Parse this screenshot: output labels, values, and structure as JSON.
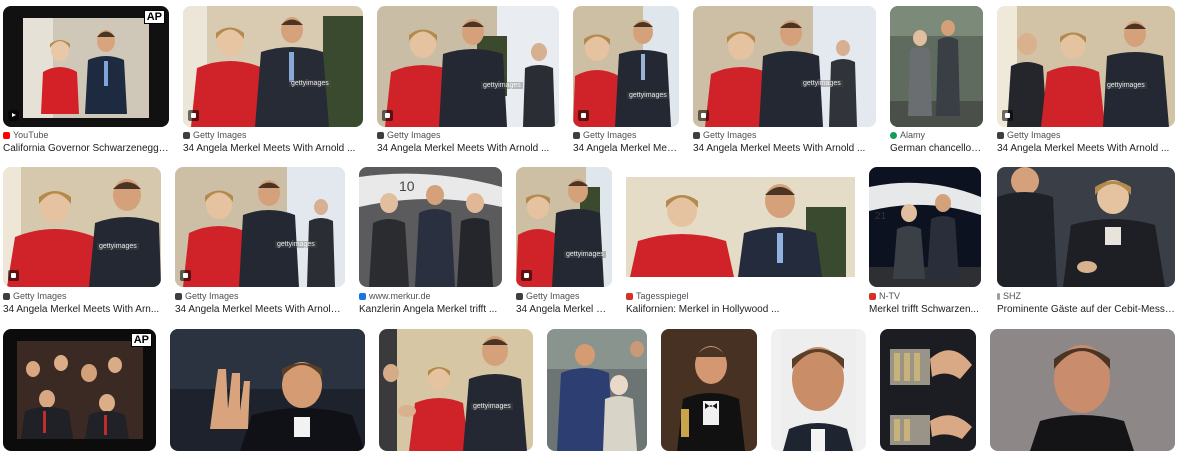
{
  "row1": [
    {
      "source": "YouTube",
      "title": "California Governor Schwarzenegge...",
      "badge": "video",
      "logo": "AP",
      "fav_color": "#ff0000"
    },
    {
      "source": "Getty Images",
      "title": "34 Angela Merkel Meets With Arnold ...",
      "badge": "image",
      "watermark": "gettyimages",
      "fav_color": "#3c4043"
    },
    {
      "source": "Getty Images",
      "title": "34 Angela Merkel Meets With Arnold ...",
      "badge": "image",
      "watermark": "gettyimages",
      "fav_color": "#3c4043"
    },
    {
      "source": "Getty Images",
      "title": "34 Angela Merkel Mee...",
      "badge": "image",
      "watermark": "gettyimages",
      "fav_color": "#3c4043"
    },
    {
      "source": "Getty Images",
      "title": "34 Angela Merkel Meets With Arnold ...",
      "badge": "image",
      "watermark": "gettyimages",
      "fav_color": "#3c4043"
    },
    {
      "source": "Alamy",
      "title": "German chancellor ...",
      "badge": "none",
      "fav_color": "#0f9d58"
    },
    {
      "source": "Getty Images",
      "title": "34 Angela Merkel Meets With Arnold ...",
      "badge": "image",
      "watermark": "gettyimages",
      "fav_color": "#3c4043"
    }
  ],
  "row2": [
    {
      "source": "Getty Images",
      "title": "34 Angela Merkel Meets With Arn...",
      "badge": "image",
      "watermark": "gettyimages",
      "fav_color": "#3c4043"
    },
    {
      "source": "Getty Images",
      "title": "34 Angela Merkel Meets With Arnold ...",
      "badge": "image",
      "watermark": "gettyimages",
      "fav_color": "#3c4043"
    },
    {
      "source": "www.merkur.de",
      "title": "Kanzlerin Angela Merkel trifft ...",
      "badge": "none",
      "fav_color": "#1a73e8"
    },
    {
      "source": "Getty Images",
      "title": "34 Angela Merkel M...",
      "badge": "image",
      "watermark": "gettyimages",
      "fav_color": "#3c4043"
    },
    {
      "source": "Tagesspiegel",
      "title": "Kalifornien: Merkel in Hollywood ...",
      "badge": "none",
      "fav_color": "#d93025"
    },
    {
      "source": "N-TV",
      "title": "Merkel trifft Schwarzen...",
      "badge": "none",
      "fav_color": "#d93025"
    },
    {
      "source": "SHZ",
      "title": "Prominente Gäste auf der Cebit-Messe | ...",
      "badge": "none",
      "fav_color": "#9aa0a6"
    }
  ],
  "row3": [
    {
      "badge": "none",
      "logo": "AP"
    },
    {
      "badge": "none"
    },
    {
      "badge": "none",
      "watermark": "gettyimages"
    },
    {
      "badge": "none"
    },
    {
      "badge": "none"
    },
    {
      "badge": "none"
    },
    {
      "badge": "none"
    },
    {
      "badge": "none"
    }
  ]
}
